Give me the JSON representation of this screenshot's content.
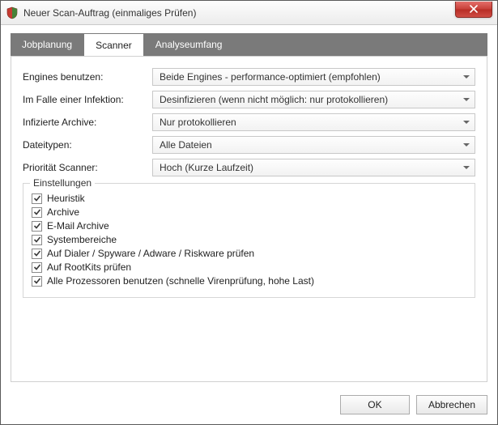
{
  "window": {
    "title": "Neuer Scan-Auftrag (einmaliges Prüfen)"
  },
  "tabs": {
    "jobplanung": "Jobplanung",
    "scanner": "Scanner",
    "analyseumfang": "Analyseumfang",
    "active": "scanner"
  },
  "form": {
    "engines": {
      "label": "Engines benutzen:",
      "value": "Beide Engines - performance-optimiert (empfohlen)"
    },
    "infection": {
      "label": "Im Falle einer Infektion:",
      "value": "Desinfizieren (wenn nicht möglich: nur protokollieren)"
    },
    "archives": {
      "label": "Infizierte Archive:",
      "value": "Nur protokollieren"
    },
    "filetypes": {
      "label": "Dateitypen:",
      "value": "Alle Dateien"
    },
    "priority": {
      "label": "Priorität Scanner:",
      "value": "Hoch (Kurze Laufzeit)"
    }
  },
  "settings": {
    "legend": "Einstellungen",
    "items": [
      {
        "label": "Heuristik",
        "checked": true
      },
      {
        "label": "Archive",
        "checked": true
      },
      {
        "label": "E-Mail Archive",
        "checked": true
      },
      {
        "label": "Systembereiche",
        "checked": true
      },
      {
        "label": "Auf Dialer / Spyware / Adware / Riskware prüfen",
        "checked": true
      },
      {
        "label": "Auf RootKits prüfen",
        "checked": true
      },
      {
        "label": "Alle Prozessoren benutzen (schnelle Virenprüfung, hohe Last)",
        "checked": true
      }
    ]
  },
  "buttons": {
    "ok": "OK",
    "cancel": "Abbrechen"
  }
}
